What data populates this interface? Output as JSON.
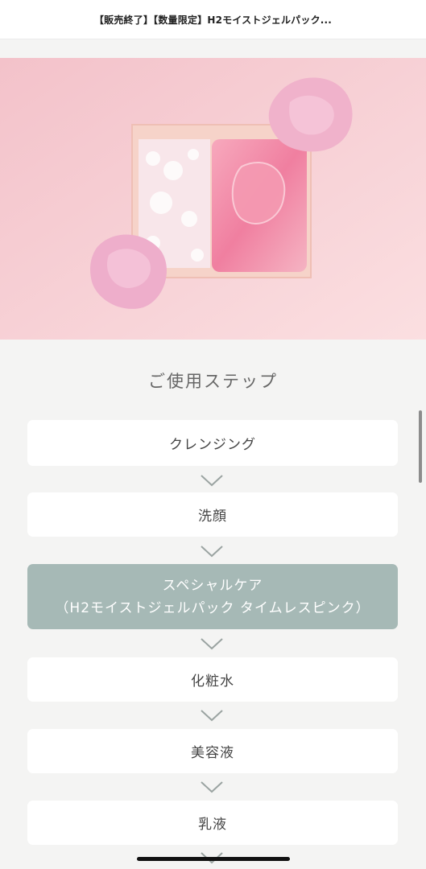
{
  "header": {
    "title": "【販売終了】【数量限定】H2モイストジェルパック..."
  },
  "hero": {
    "image_icon": "product-gel-pack-image",
    "colors": {
      "background": "#f4c9cf",
      "gel": "#f7a8bc",
      "dough": "#f2b6cf"
    }
  },
  "section": {
    "title": "ご使用ステップ"
  },
  "steps": [
    {
      "label": "クレンジング"
    },
    {
      "label": "洗顔"
    },
    {
      "label": "スペシャルケア",
      "sublabel": "（H2モイストジェルパック タイムレスピンク）"
    },
    {
      "label": "化粧水"
    },
    {
      "label": "美容液"
    },
    {
      "label": "乳液"
    }
  ],
  "colors": {
    "highlight": "#a6b9b6",
    "arrow": "#9aa3a1"
  },
  "icons": {
    "arrow": "chevron-down-icon"
  }
}
